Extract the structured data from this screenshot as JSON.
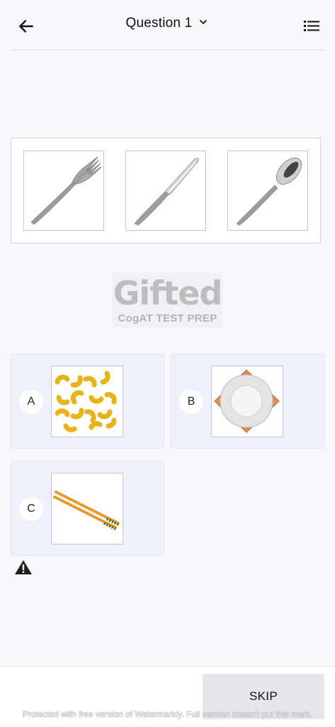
{
  "header": {
    "title": "Question 1",
    "back_icon": "arrow-left-icon",
    "dropdown_icon": "chevron-down-icon",
    "menu_icon": "list-icon"
  },
  "question": {
    "images": [
      "fork",
      "knife",
      "spoon"
    ]
  },
  "logo": {
    "word": "Gifted",
    "subtitle": "CogAT TEST PREP"
  },
  "options": [
    {
      "letter": "A",
      "image": "macaroni"
    },
    {
      "letter": "B",
      "image": "plate"
    },
    {
      "letter": "C",
      "image": "chopsticks"
    }
  ],
  "report_icon": "warning-icon",
  "footer": {
    "skip_label": "SKIP",
    "watermark": "Protected with free version of Watermarkly. Full version doesn't put this mark."
  },
  "colors": {
    "background": "#f8f8fb",
    "option_bg": "#eef0fb",
    "image_border": "#c9c2e6",
    "skip_bg": "#e7e7e9"
  }
}
